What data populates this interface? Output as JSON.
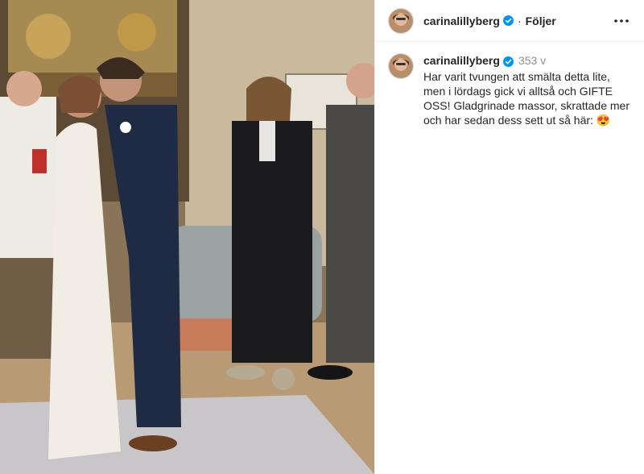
{
  "post": {
    "username": "carinalillyberg",
    "follow_label": "Följer",
    "separator": "·",
    "caption_username": "carinalillyberg",
    "time": "353 v",
    "caption_text": "Har varit tvungen att smälta detta lite, men i lördags gick vi alltså och GIFTE OSS! Gladgrinade massor, skrattade mer och har sedan dess sett ut så här: 😍"
  },
  "icons": {
    "verified": "verified-badge-icon",
    "more": "more-options-icon"
  },
  "colors": {
    "verified_blue": "#0095f6",
    "text": "#262626",
    "secondary": "#8e8e8e",
    "divider": "#efefef"
  }
}
